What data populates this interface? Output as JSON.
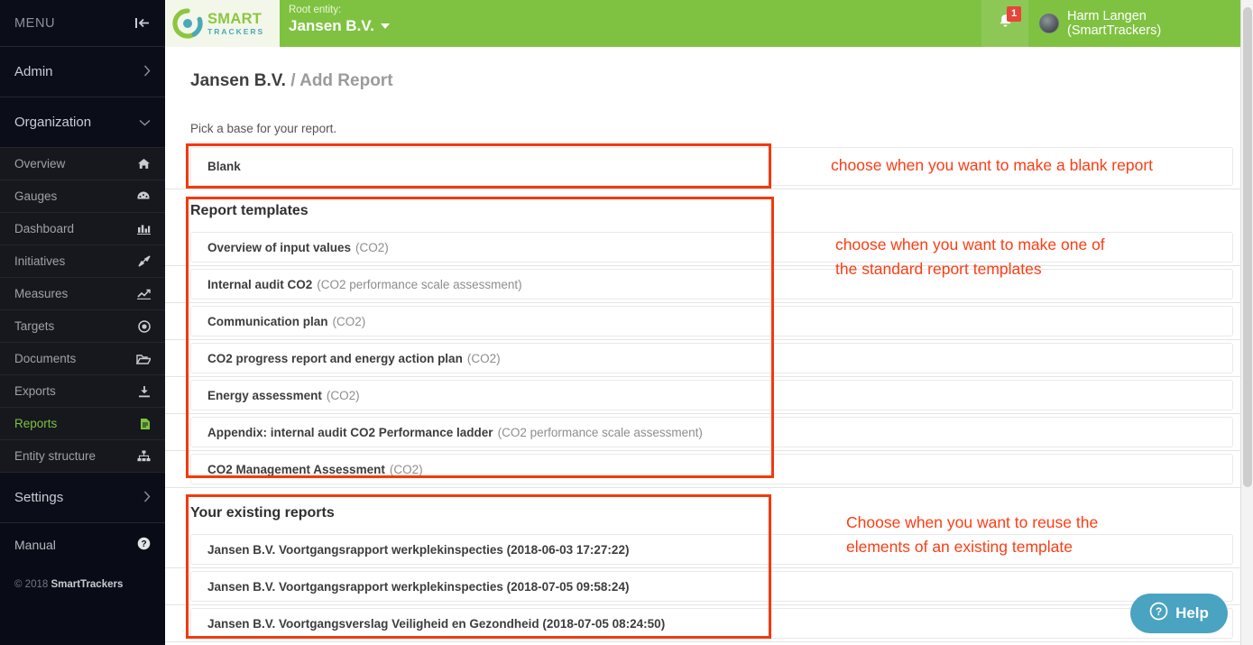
{
  "sidebar": {
    "menu_label": "MENU",
    "collapse_icon": "collapse-left-icon",
    "groups": [
      {
        "label": "Admin",
        "icon": "chevron-right-icon"
      },
      {
        "label": "Organization",
        "icon": "chevron-down-icon"
      }
    ],
    "items": [
      {
        "label": "Overview",
        "icon": "home-icon"
      },
      {
        "label": "Gauges",
        "icon": "gauge-icon"
      },
      {
        "label": "Dashboard",
        "icon": "bar-chart-icon"
      },
      {
        "label": "Initiatives",
        "icon": "expand-arrows-icon"
      },
      {
        "label": "Measures",
        "icon": "line-chart-icon"
      },
      {
        "label": "Targets",
        "icon": "target-icon"
      },
      {
        "label": "Documents",
        "icon": "folder-open-icon"
      },
      {
        "label": "Exports",
        "icon": "download-icon"
      },
      {
        "label": "Reports",
        "icon": "file-text-icon"
      },
      {
        "label": "Entity structure",
        "icon": "sitemap-icon"
      }
    ],
    "active_item": "Reports",
    "settings": {
      "label": "Settings",
      "icon": "chevron-right-icon"
    },
    "manual": {
      "label": "Manual",
      "icon": "question-circle-icon"
    },
    "copyright_prefix": "© 2018 ",
    "copyright_brand": "SmartTrackers"
  },
  "topbar": {
    "logo": {
      "line1": "SMART",
      "line2": "TRACKERS",
      "icon": "smarttrackers-logo-icon"
    },
    "root_entity_label": "Root entity:",
    "root_entity_value": "Jansen B.V.",
    "notifications": {
      "icon": "bell-icon",
      "count": "1"
    },
    "user_name": "Harm Langen (SmartTrackers)",
    "avatar_icon": "user-avatar"
  },
  "main": {
    "breadcrumb_entity": "Jansen B.V.",
    "breadcrumb_page": " / Add Report",
    "subtitle": "Pick a base for your report.",
    "blank_option": "Blank",
    "templates_heading": "Report templates",
    "templates": [
      {
        "name": "Overview of input values",
        "paren": "(CO2)"
      },
      {
        "name": "Internal audit CO2",
        "paren": "(CO2 performance scale assessment)"
      },
      {
        "name": "Communication plan",
        "paren": "(CO2)"
      },
      {
        "name": "CO2 progress report and energy action plan",
        "paren": "(CO2)"
      },
      {
        "name": "Energy assessment",
        "paren": "(CO2)"
      },
      {
        "name": "Appendix: internal audit CO2 Performance ladder",
        "paren": "(CO2 performance scale assessment)"
      },
      {
        "name": "CO2 Management Assessment",
        "paren": "(CO2)"
      }
    ],
    "existing_heading": "Your existing reports",
    "existing_reports": [
      {
        "name": "Jansen B.V. Voortgangsrapport werkplekinspecties (2018-06-03 17:27:22)"
      },
      {
        "name": "Jansen B.V. Voortgangsrapport werkplekinspecties (2018-07-05 09:58:24)"
      },
      {
        "name": "Jansen B.V. Voortgangsverslag Veiligheid en Gezondheid (2018-07-05 08:24:50)"
      }
    ]
  },
  "annotations": [
    {
      "text": "choose when you want to make a blank report"
    },
    {
      "text": "choose when you want to make one of\nthe standard report templates"
    },
    {
      "text": "Choose when you want to reuse the\nelements of an existing template"
    }
  ],
  "help": {
    "label": "Help",
    "icon": "question-circle-icon"
  },
  "colors": {
    "brand_green": "#7fc241",
    "sidebar_dark": "#090c16",
    "annotation_red": "#fc3d14",
    "accent_teal": "#4aa3c0",
    "badge_red": "#e8443a",
    "active_green": "#7dc242"
  }
}
